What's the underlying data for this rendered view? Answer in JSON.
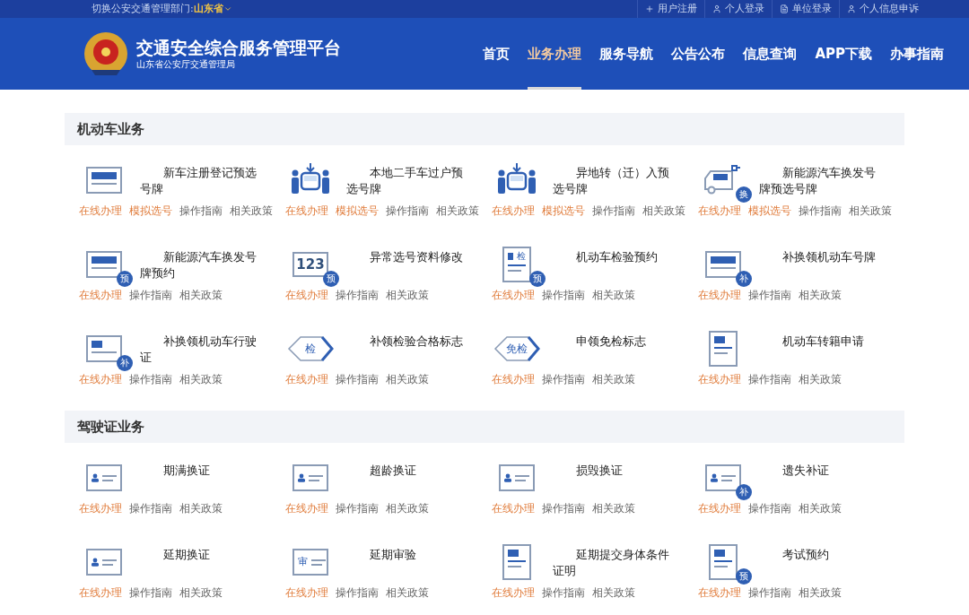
{
  "top_bar": {
    "department_label": "切换公安交通管理部门:",
    "department": "山东省",
    "links": [
      {
        "label": "用户注册",
        "kind": "register"
      },
      {
        "label": "个人登录",
        "kind": "person"
      },
      {
        "label": "单位登录",
        "kind": "company"
      },
      {
        "label": "个人信息申诉",
        "kind": "person"
      }
    ]
  },
  "header": {
    "title": "交通安全综合服务管理平台",
    "subtitle": "山东省公安厅交通管理局",
    "nav": [
      {
        "label": "首页",
        "selected": false
      },
      {
        "label": "业务办理",
        "selected": true
      },
      {
        "label": "服务导航",
        "selected": false
      },
      {
        "label": "公告公布",
        "selected": false
      },
      {
        "label": "信息查询",
        "selected": false
      },
      {
        "label": "APP下载",
        "selected": false
      },
      {
        "label": "办事指南",
        "selected": false
      }
    ]
  },
  "sections": [
    {
      "title": "机动车业务",
      "items": [
        {
          "title": "新车注册登记预选号牌",
          "icon": {
            "kind": "plate"
          },
          "links": [
            {
              "label": "在线办理",
              "kind": "primary"
            },
            {
              "label": "模拟选号",
              "kind": "primary"
            },
            {
              "label": "操作指南",
              "kind": "secondary"
            },
            {
              "label": "相关政策",
              "kind": "secondary"
            }
          ]
        },
        {
          "title": "本地二手车过户预选号牌",
          "icon": {
            "kind": "people"
          },
          "links": [
            {
              "label": "在线办理",
              "kind": "primary"
            },
            {
              "label": "模拟选号",
              "kind": "primary"
            },
            {
              "label": "操作指南",
              "kind": "secondary"
            },
            {
              "label": "相关政策",
              "kind": "secondary"
            }
          ]
        },
        {
          "title": "异地转（迁）入预选号牌",
          "icon": {
            "kind": "people"
          },
          "links": [
            {
              "label": "在线办理",
              "kind": "primary"
            },
            {
              "label": "模拟选号",
              "kind": "primary"
            },
            {
              "label": "操作指南",
              "kind": "secondary"
            },
            {
              "label": "相关政策",
              "kind": "secondary"
            }
          ]
        },
        {
          "title": "新能源汽车换发号牌预选号牌",
          "icon": {
            "kind": "car",
            "badge": "换"
          },
          "links": [
            {
              "label": "在线办理",
              "kind": "primary"
            },
            {
              "label": "模拟选号",
              "kind": "primary"
            },
            {
              "label": "操作指南",
              "kind": "secondary"
            },
            {
              "label": "相关政策",
              "kind": "secondary"
            }
          ]
        },
        {
          "title": "新能源汽车换发号牌预约",
          "icon": {
            "kind": "plate",
            "badge": "预"
          },
          "links": [
            {
              "label": "在线办理",
              "kind": "primary"
            },
            {
              "label": "操作指南",
              "kind": "secondary"
            },
            {
              "label": "相关政策",
              "kind": "secondary"
            }
          ]
        },
        {
          "title": "异常选号资料修改",
          "icon": {
            "kind": "number",
            "label": "123",
            "badge": "预"
          },
          "links": [
            {
              "label": "在线办理",
              "kind": "primary"
            },
            {
              "label": "操作指南",
              "kind": "secondary"
            },
            {
              "label": "相关政策",
              "kind": "secondary"
            }
          ]
        },
        {
          "title": "机动车检验预约",
          "icon": {
            "kind": "form",
            "label": "检",
            "badge": "预"
          },
          "links": [
            {
              "label": "在线办理",
              "kind": "primary"
            },
            {
              "label": "操作指南",
              "kind": "secondary"
            },
            {
              "label": "相关政策",
              "kind": "secondary"
            }
          ]
        },
        {
          "title": "补换领机动车号牌",
          "icon": {
            "kind": "plate",
            "badge": "补"
          },
          "links": [
            {
              "label": "在线办理",
              "kind": "primary"
            },
            {
              "label": "操作指南",
              "kind": "secondary"
            },
            {
              "label": "相关政策",
              "kind": "secondary"
            }
          ]
        },
        {
          "title": "补换领机动车行驶证",
          "icon": {
            "kind": "card",
            "badge": "补"
          },
          "links": [
            {
              "label": "在线办理",
              "kind": "primary"
            },
            {
              "label": "操作指南",
              "kind": "secondary"
            },
            {
              "label": "相关政策",
              "kind": "secondary"
            }
          ]
        },
        {
          "title": "补领检验合格标志",
          "icon": {
            "kind": "diamond",
            "label": "检"
          },
          "links": [
            {
              "label": "在线办理",
              "kind": "primary"
            },
            {
              "label": "操作指南",
              "kind": "secondary"
            },
            {
              "label": "相关政策",
              "kind": "secondary"
            }
          ]
        },
        {
          "title": "申领免检标志",
          "icon": {
            "kind": "diamond",
            "label": "免检"
          },
          "links": [
            {
              "label": "在线办理",
              "kind": "primary"
            },
            {
              "label": "操作指南",
              "kind": "secondary"
            },
            {
              "label": "相关政策",
              "kind": "secondary"
            }
          ]
        },
        {
          "title": "机动车转籍申请",
          "icon": {
            "kind": "form"
          },
          "links": [
            {
              "label": "在线办理",
              "kind": "primary"
            },
            {
              "label": "操作指南",
              "kind": "secondary"
            },
            {
              "label": "相关政策",
              "kind": "secondary"
            }
          ]
        }
      ]
    },
    {
      "title": "驾驶证业务",
      "items": [
        {
          "title": "期满换证",
          "icon": {
            "kind": "id"
          },
          "links": [
            {
              "label": "在线办理",
              "kind": "primary"
            },
            {
              "label": "操作指南",
              "kind": "secondary"
            },
            {
              "label": "相关政策",
              "kind": "secondary"
            }
          ]
        },
        {
          "title": "超龄换证",
          "icon": {
            "kind": "id"
          },
          "links": [
            {
              "label": "在线办理",
              "kind": "primary"
            },
            {
              "label": "操作指南",
              "kind": "secondary"
            },
            {
              "label": "相关政策",
              "kind": "secondary"
            }
          ]
        },
        {
          "title": "损毁换证",
          "icon": {
            "kind": "id"
          },
          "links": [
            {
              "label": "在线办理",
              "kind": "primary"
            },
            {
              "label": "操作指南",
              "kind": "secondary"
            },
            {
              "label": "相关政策",
              "kind": "secondary"
            }
          ]
        },
        {
          "title": "遗失补证",
          "icon": {
            "kind": "id",
            "badge": "补"
          },
          "links": [
            {
              "label": "在线办理",
              "kind": "primary"
            },
            {
              "label": "操作指南",
              "kind": "secondary"
            },
            {
              "label": "相关政策",
              "kind": "secondary"
            }
          ]
        },
        {
          "title": "延期换证",
          "icon": {
            "kind": "id"
          },
          "links": [
            {
              "label": "在线办理",
              "kind": "primary"
            },
            {
              "label": "操作指南",
              "kind": "secondary"
            },
            {
              "label": "相关政策",
              "kind": "secondary"
            }
          ]
        },
        {
          "title": "延期审验",
          "icon": {
            "kind": "id",
            "label": "审"
          },
          "links": [
            {
              "label": "在线办理",
              "kind": "primary"
            },
            {
              "label": "操作指南",
              "kind": "secondary"
            },
            {
              "label": "相关政策",
              "kind": "secondary"
            }
          ]
        },
        {
          "title": "延期提交身体条件证明",
          "icon": {
            "kind": "form"
          },
          "links": [
            {
              "label": "在线办理",
              "kind": "primary"
            },
            {
              "label": "操作指南",
              "kind": "secondary"
            },
            {
              "label": "相关政策",
              "kind": "secondary"
            }
          ]
        },
        {
          "title": "考试预约",
          "icon": {
            "kind": "form",
            "badge": "预"
          },
          "links": [
            {
              "label": "在线办理",
              "kind": "primary"
            },
            {
              "label": "操作指南",
              "kind": "secondary"
            },
            {
              "label": "相关政策",
              "kind": "secondary"
            }
          ]
        }
      ]
    }
  ]
}
